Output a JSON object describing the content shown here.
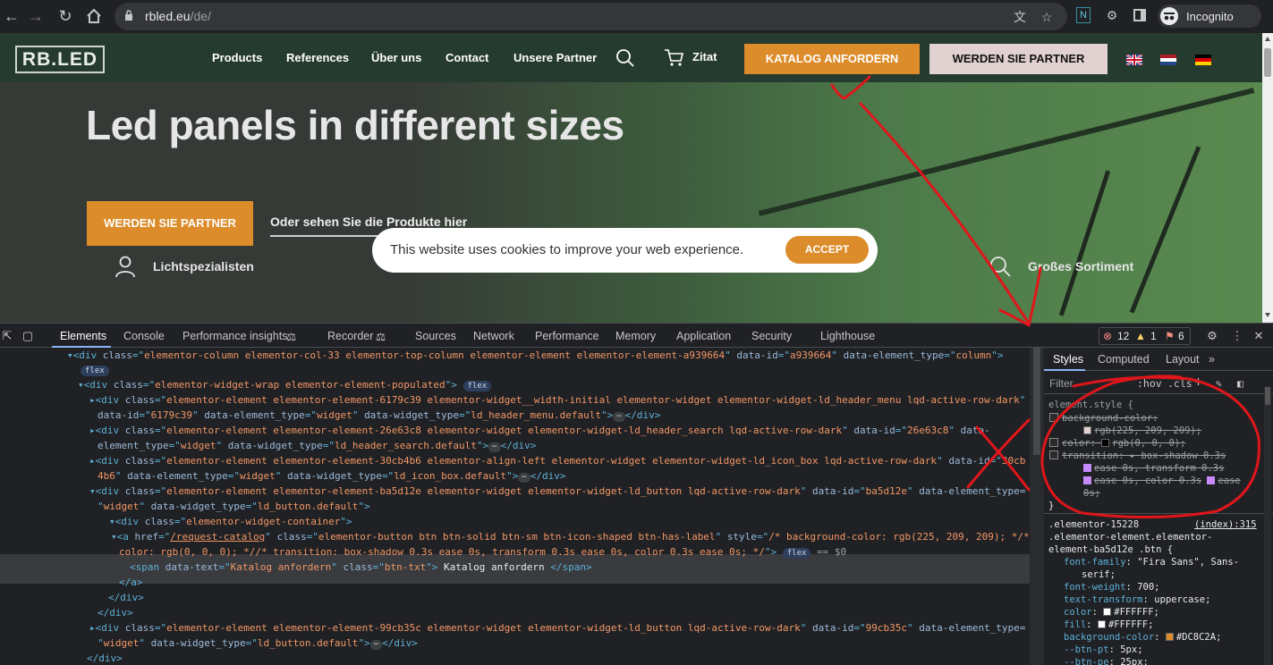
{
  "browser": {
    "url_host": "rbled.eu",
    "url_path": "/de/",
    "incognito_label": "Incognito"
  },
  "site": {
    "logo": "RB.LED",
    "nav": [
      "Products",
      "References",
      "Über uns",
      "Contact",
      "Unsere Partner"
    ],
    "cart_label": "Zitat",
    "cta_catalog": "KATALOG ANFORDERN",
    "cta_partner": "WERDEN SIE PARTNER",
    "hero_title": "Led panels in different sizes",
    "hero_button": "WERDEN SIE PARTNER",
    "hero_link": "Oder sehen Sie die Produkte hier",
    "feature_left": "Lichtspezialisten",
    "feature_right": "Großes Sortiment",
    "cookie_text": "This website uses cookies to improve your web experience.",
    "cookie_accept": "ACCEPT",
    "colors": {
      "accent": "#DC8C2A",
      "partner_bg": "#E1D1D1",
      "header_bg": "#263B2F"
    }
  },
  "devtools": {
    "tabs": [
      "Elements",
      "Console",
      "Performance insights",
      "Recorder",
      "Sources",
      "Network",
      "Performance",
      "Memory",
      "Application",
      "Security",
      "Lighthouse"
    ],
    "errors": "12",
    "warnings": "1",
    "issues": "6",
    "dom": {
      "l1_tag": "div",
      "l1_class": "elementor-column elementor-col-33 elementor-top-column elementor-element elementor-element-a939664",
      "l1_id": "a939664",
      "l1_type": "column",
      "flex": "flex",
      "l2_class": "elementor-widget-wrap elementor-element-populated",
      "l3_class": "elementor-element elementor-element-6179c39 elementor-widget__width-initial elementor-widget elementor-widget-ld_header_menu lqd-active-row-dark",
      "l3_id": "6179c39",
      "l3_type": "widget",
      "l3_wtype": "ld_header_menu.default",
      "l4_class": "elementor-element elementor-element-26e63c8 elementor-widget elementor-widget-ld_header_search lqd-active-row-dark",
      "l4_id_a": "26e63c8",
      "l4_wtype": "ld_header_search.default",
      "l5_class": "elementor-element elementor-element-30cb4b6 elementor-align-left elementor-widget elementor-widget-ld_icon_box lqd-active-row-dark",
      "l5_id_a": "30cb",
      "l5_id_b": "4b6",
      "l5_wtype": "ld_icon_box.default",
      "l6_class": "elementor-element elementor-element-ba5d12e elementor-widget elementor-widget-ld_button lqd-active-row-dark",
      "l6_id": "ba5d12e",
      "l6_wtype": "ld_button.default",
      "l7_class": "elementor-widget-container",
      "a_href": "/request-catalog",
      "a_class": "elementor-button btn btn-solid btn-sm btn-icon-shaped btn-has-label",
      "a_style_1": "/* background-color: rgb(225, 209, 209); */",
      "a_style_2": " color: rgb(0, 0, 0); *//* transition: box-shadow 0.3s ease 0s, transform 0.3s ease 0s, color 0.3s ease 0s; */",
      "eq": "== $0",
      "span_text_attr": "Katalog anfordern",
      "span_class": "btn-txt",
      "span_text": " Katalog anfordern ",
      "l9_class": "elementor-element elementor-element-99cb35c elementor-widget elementor-widget-ld_button lqd-active-row-dark",
      "l9_id": "99cb35c",
      "l9_wtype": "ld_button.default"
    },
    "styles": {
      "tabs": [
        "Styles",
        "Computed",
        "Layout"
      ],
      "filter": "Filter",
      "hov": ":hov",
      "cls": ".cls",
      "element_style": "element.style {",
      "bg_prop": "background-color",
      "bg_val": "rgb(225, 209, 209);",
      "color_prop": "color",
      "color_val": "rgb(0, 0, 0);",
      "trans_prop": "transition",
      "trans_val_1": "box-shadow 0.3s",
      "trans_val_2": "ease 0s, transform 0.3s",
      "trans_val_3": "ease 0s, color 0.3s",
      "trans_val_4": "ease",
      "trans_val_5": "0s;",
      "close_brace": "}",
      "rule_sel_1": ".elementor-15228",
      "rule_src": "(index):315",
      "rule_sel_2": ".elementor-element.elementor-",
      "rule_sel_3": "element-ba5d12e .btn {",
      "props": [
        {
          "name": "font-family",
          "value": "\"Fira Sans\", Sans-"
        },
        {
          "name": "",
          "value": "serif;"
        },
        {
          "name": "font-weight",
          "value": "700;"
        },
        {
          "name": "text-transform",
          "value": "uppercase;"
        },
        {
          "name": "color",
          "value": "#FFFFFF;"
        },
        {
          "name": "fill",
          "value": "#FFFFFF;"
        },
        {
          "name": "background-color",
          "value": "#DC8C2A;"
        },
        {
          "name": "--btn-pt",
          "value": "5px;"
        },
        {
          "name": "--btn-pe",
          "value": "25px;"
        }
      ]
    }
  }
}
